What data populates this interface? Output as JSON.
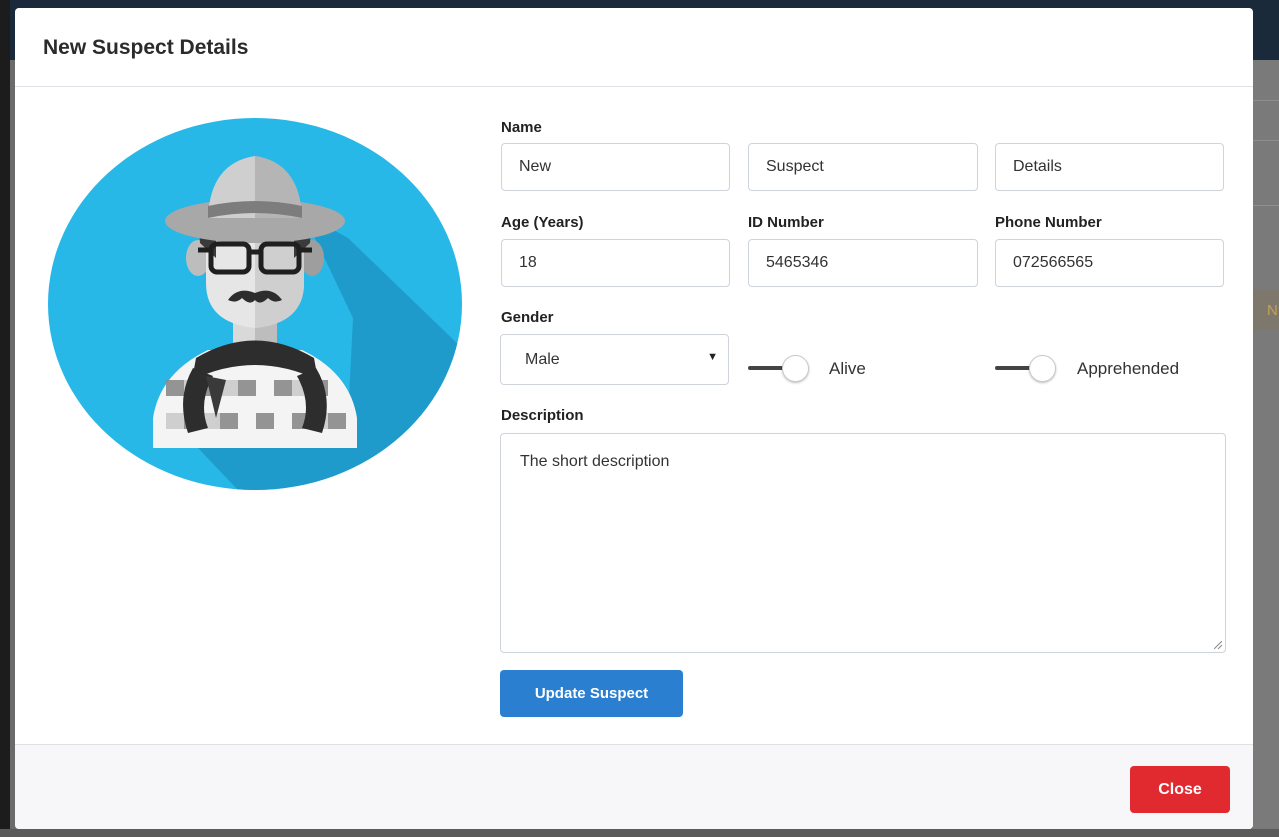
{
  "modal": {
    "title": "New Suspect Details"
  },
  "form": {
    "name_label": "Name",
    "first_name": "New",
    "middle_name": "Suspect",
    "last_name": "Details",
    "age_label": "Age (Years)",
    "age": "18",
    "id_label": "ID Number",
    "id_number": "5465346",
    "phone_label": "Phone Number",
    "phone": "072566565",
    "gender_label": "Gender",
    "gender": "Male",
    "alive_label": "Alive",
    "apprehended_label": "Apprehended",
    "description_label": "Description",
    "description": "The short description",
    "submit_label": "Update Suspect"
  },
  "footer": {
    "close_label": "Close"
  },
  "background": {
    "peek_text": "N"
  },
  "colors": {
    "avatar_circle": "#27b8e8",
    "primary": "#2b7fd0",
    "danger": "#e12a2f"
  },
  "icons": {
    "avatar": "suspect-avatar-illustration",
    "select_caret": "caret-down-icon",
    "resize": "resize-grip-icon"
  }
}
